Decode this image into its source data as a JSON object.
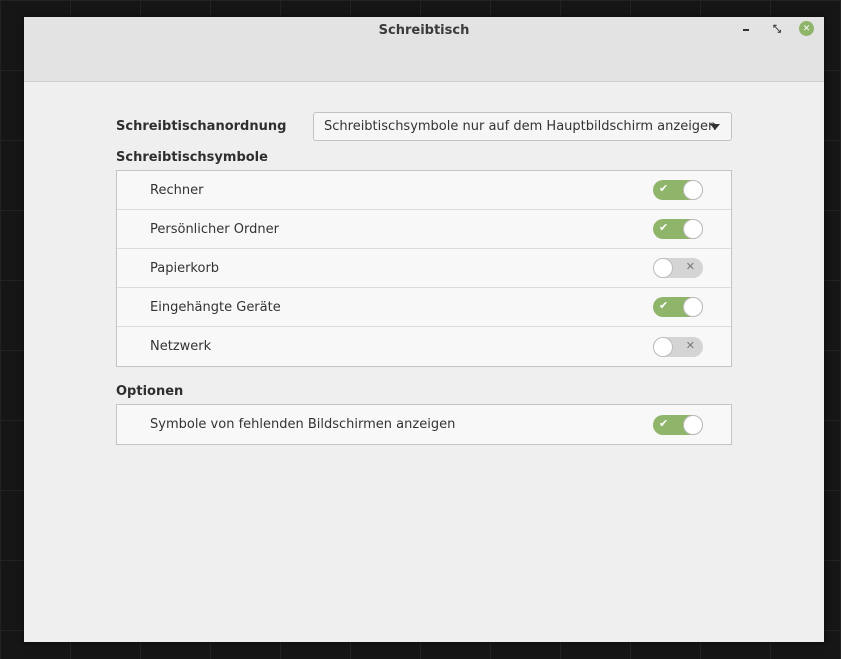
{
  "window": {
    "title": "Schreibtisch"
  },
  "wm": {
    "minimize_glyph": "",
    "maximize_glyph": "⤡",
    "close_glyph": "✕"
  },
  "arrangement": {
    "label": "Schreibtischanordnung",
    "selected": "Schreibtischsymbole nur auf dem Hauptbildschirm anzeigen"
  },
  "desktop_icons": {
    "heading": "Schreibtischsymbole",
    "items": [
      {
        "label": "Rechner",
        "enabled": true
      },
      {
        "label": "Persönlicher Ordner",
        "enabled": true
      },
      {
        "label": "Papierkorb",
        "enabled": false
      },
      {
        "label": "Eingehängte Geräte",
        "enabled": true
      },
      {
        "label": "Netzwerk",
        "enabled": false
      }
    ]
  },
  "options": {
    "heading": "Optionen",
    "items": [
      {
        "label": "Symbole von fehlenden Bildschirmen anzeigen",
        "enabled": true
      }
    ]
  },
  "switch_glyphs": {
    "on": "✔",
    "off": "✕"
  },
  "colors": {
    "accent": "#8fb56b",
    "switch_off": "#d4d4d4"
  }
}
